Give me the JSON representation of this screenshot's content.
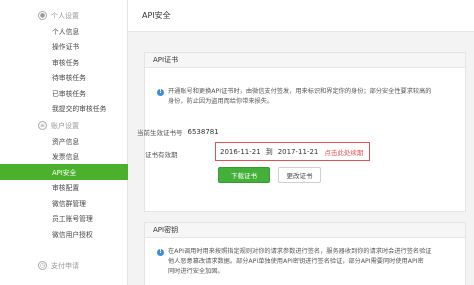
{
  "sidebar": {
    "groups": [
      {
        "icon": "user-icon",
        "glyph": "●",
        "title": "个人设置",
        "items": [
          "个人信息",
          "操作证书",
          "审核任务",
          "待审核任务",
          "已审核任务",
          "我提交的审核任务"
        ]
      },
      {
        "icon": "account-icon",
        "glyph": "≡",
        "title": "账户设置",
        "items": [
          "资产信息",
          "发票信息",
          "API安全",
          "审核配置",
          "微信群管理",
          "员工账号管理",
          "微信用户授权"
        ]
      },
      {
        "icon": "payment-icon",
        "glyph": "◷",
        "title": "支付申请",
        "items": []
      }
    ],
    "active_item": "API安全"
  },
  "main": {
    "title": "API安全",
    "cert_panel": {
      "head": "API证书",
      "info_line1": "开通账号和更换API证书时，由微信支付签发，用来标识和界定你的身份；部分安全性要求较高的",
      "info_line2": "身份，防止因为盗用而给你带来损失。",
      "serial_label": "当前生效证书号",
      "serial_value": "6538781",
      "validity_label": "证书有效期",
      "validity_start": "2016-11-21",
      "validity_to": "到",
      "validity_end": "2017-11-21",
      "validity_note": "点击此处续期",
      "download_button": "下载证书",
      "change_button": "更改证书"
    },
    "key_panel": {
      "head": "API密钥",
      "info_line1": "在API调用时用来按照指定规则对你的请求参数进行签名，服务器收到你的请求时会进行签名验证",
      "info_line2": "他人恶意篡改请求数据。部分API单独使用API密钥进行签名验证，部分API需要同时使用API密",
      "info_line3": "同时进行安全加固。"
    }
  },
  "colors": {
    "active": "#4bb02b",
    "primary_button": "#44b03a",
    "info_icon": "#3e8bd6",
    "alert": "#e65050"
  }
}
